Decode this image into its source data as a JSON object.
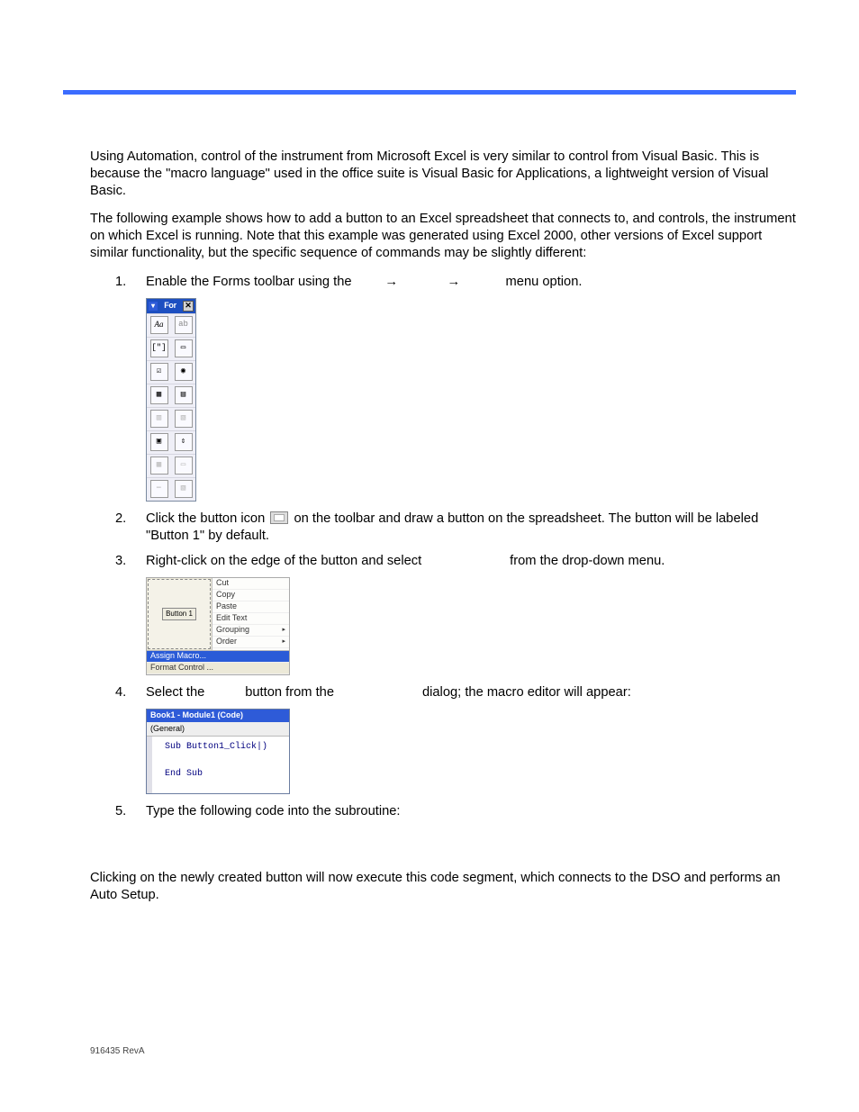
{
  "intro_para1": "Using Automation, control of the instrument from Microsoft Excel is very similar to control from Visual Basic. This is because the \"macro language\" used in the office suite is Visual Basic for Applications, a lightweight version of Visual Basic.",
  "intro_para2": "The following example shows how to add a button to an Excel spreadsheet that connects to, and controls, the instrument on which Excel is running. Note that this example was generated using Excel 2000, other versions of Excel support similar functionality, but the specific sequence of commands may be slightly different:",
  "step1_a": "Enable the Forms toolbar using the",
  "step1_b": "menu option.",
  "step2_a": "Click the button icon",
  "step2_b": "on the toolbar and draw a button on the spreadsheet. The button will be labeled \"Button 1\" by default.",
  "step3_a": "Right-click on the edge of the button and select",
  "step3_b": "from the drop-down menu.",
  "step4_a": "Select the",
  "step4_b": "button from the",
  "step4_c": "dialog; the macro editor will appear:",
  "step5": "Type the following code into the subroutine:",
  "closing": "Clicking on the newly created button will now execute this code segment, which connects to the DSO and performs an Auto Setup.",
  "footer": "916435 RevA",
  "forms_toolbar": {
    "title": "For",
    "rows": [
      [
        "Aa",
        "ab"
      ],
      [
        "[\"]",
        "▭"
      ],
      [
        "☑",
        "◉"
      ],
      [
        "▦",
        "▤"
      ],
      [
        "▥",
        "▧"
      ],
      [
        "▣",
        "⇕"
      ],
      [
        "▦",
        "▭"
      ],
      [
        "⋯",
        "▧"
      ]
    ]
  },
  "context_menu": {
    "button_label": "Button 1",
    "items": [
      "Cut",
      "Copy",
      "Paste",
      "Edit Text",
      "Grouping",
      "Order",
      "Assign Macro...",
      "Format Control ..."
    ]
  },
  "code_window": {
    "title": "Book1 - Module1 (Code)",
    "combo": "(General)",
    "line1": "Sub Button1_Click|)",
    "line2": "End Sub"
  }
}
